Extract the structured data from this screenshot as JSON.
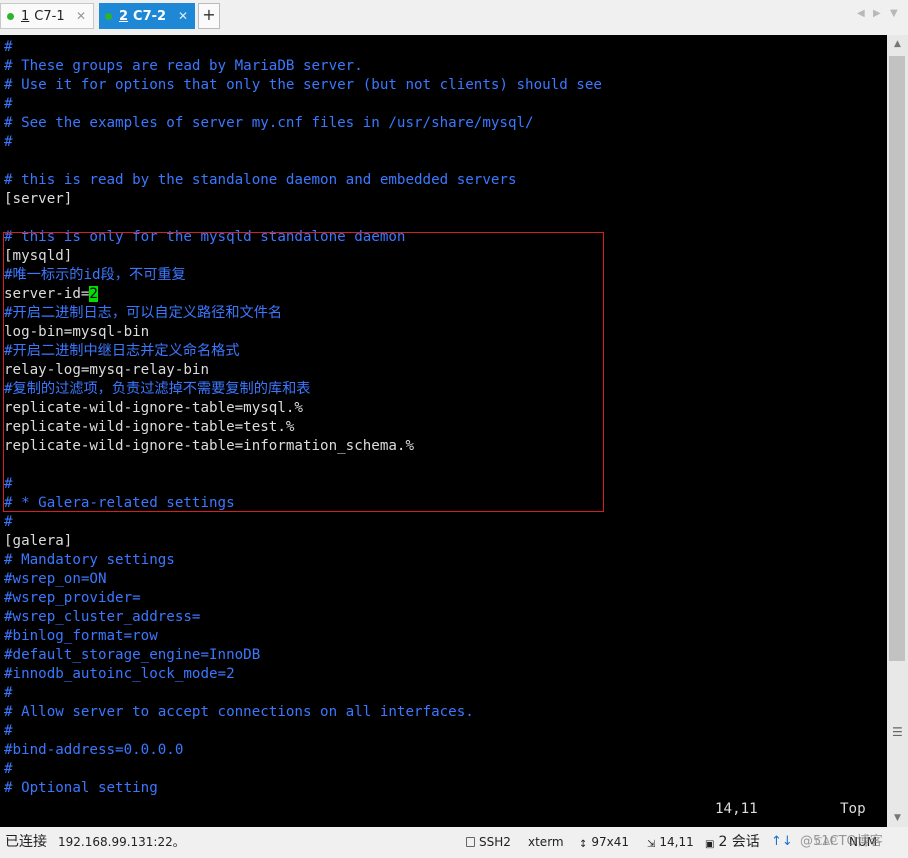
{
  "tabs": [
    {
      "num": "1",
      "label": "C7-1",
      "close": "✕"
    },
    {
      "num": "2",
      "label": "C7-2",
      "close": "✕"
    }
  ],
  "add_tab": "+",
  "nav": {
    "prev": "◀",
    "next": "▶",
    "menu": "▼"
  },
  "terminal": {
    "lines": [
      {
        "t": "#",
        "c": "c"
      },
      {
        "t": "# These groups are read by MariaDB server.",
        "c": "c"
      },
      {
        "t": "# Use it for options that only the server (but not clients) should see",
        "c": "c"
      },
      {
        "t": "#",
        "c": "c"
      },
      {
        "t": "# See the examples of server my.cnf files in /usr/share/mysql/",
        "c": "c"
      },
      {
        "t": "#",
        "c": "c"
      },
      {
        "t": "",
        "c": "c"
      },
      {
        "t": "# this is read by the standalone daemon and embedded servers",
        "c": "c"
      },
      {
        "t": "[server]",
        "c": "w"
      },
      {
        "t": "",
        "c": "c"
      },
      {
        "t": "# this is only for the mysqld standalone daemon",
        "c": "c"
      },
      {
        "t": "[mysqld]",
        "c": "w"
      },
      {
        "t": "#唯一标示的id段，不可重复",
        "c": "c"
      },
      {
        "t": "server-id=",
        "c": "w",
        "cursor": "2"
      },
      {
        "t": "#开启二进制日志，可以自定义路径和文件名",
        "c": "c"
      },
      {
        "t": "log-bin=mysql-bin",
        "c": "w"
      },
      {
        "t": "#开启二进制中继日志并定义命名格式",
        "c": "c"
      },
      {
        "t": "relay-log=mysq-relay-bin",
        "c": "w"
      },
      {
        "t": "#复制的过滤项，负责过滤掉不需要复制的库和表",
        "c": "c"
      },
      {
        "t": "replicate-wild-ignore-table=mysql.%",
        "c": "w"
      },
      {
        "t": "replicate-wild-ignore-table=test.%",
        "c": "w"
      },
      {
        "t": "replicate-wild-ignore-table=information_schema.%",
        "c": "w"
      },
      {
        "t": "",
        "c": "c"
      },
      {
        "t": "#",
        "c": "c"
      },
      {
        "t": "# * Galera-related settings",
        "c": "c"
      },
      {
        "t": "#",
        "c": "c"
      },
      {
        "t": "[galera]",
        "c": "w"
      },
      {
        "t": "# Mandatory settings",
        "c": "c"
      },
      {
        "t": "#wsrep_on=ON",
        "c": "c"
      },
      {
        "t": "#wsrep_provider=",
        "c": "c"
      },
      {
        "t": "#wsrep_cluster_address=",
        "c": "c"
      },
      {
        "t": "#binlog_format=row",
        "c": "c"
      },
      {
        "t": "#default_storage_engine=InnoDB",
        "c": "c"
      },
      {
        "t": "#innodb_autoinc_lock_mode=2",
        "c": "c"
      },
      {
        "t": "#",
        "c": "c"
      },
      {
        "t": "# Allow server to accept connections on all interfaces.",
        "c": "c"
      },
      {
        "t": "#",
        "c": "c"
      },
      {
        "t": "#bind-address=0.0.0.0",
        "c": "c"
      },
      {
        "t": "#",
        "c": "c"
      },
      {
        "t": "# Optional setting",
        "c": "c"
      }
    ],
    "ruler_pos": "14,11",
    "ruler_scroll": "Top"
  },
  "status": {
    "connection": "已连接 ",
    "host": "192.168.99.131:22。",
    "protocol": "SSH2",
    "term": "xterm",
    "size": "97x41",
    "cursor": "14,11",
    "sessions": "2 会话",
    "caps": "CAP",
    "num": "NUM"
  },
  "watermark": "@51CTO博客",
  "colors": {
    "comment": "#3b78ff",
    "text": "#dcdcdc",
    "cursor": "#00e000",
    "highlight_box": "#d62020",
    "tab_active": "#1e88d6"
  }
}
